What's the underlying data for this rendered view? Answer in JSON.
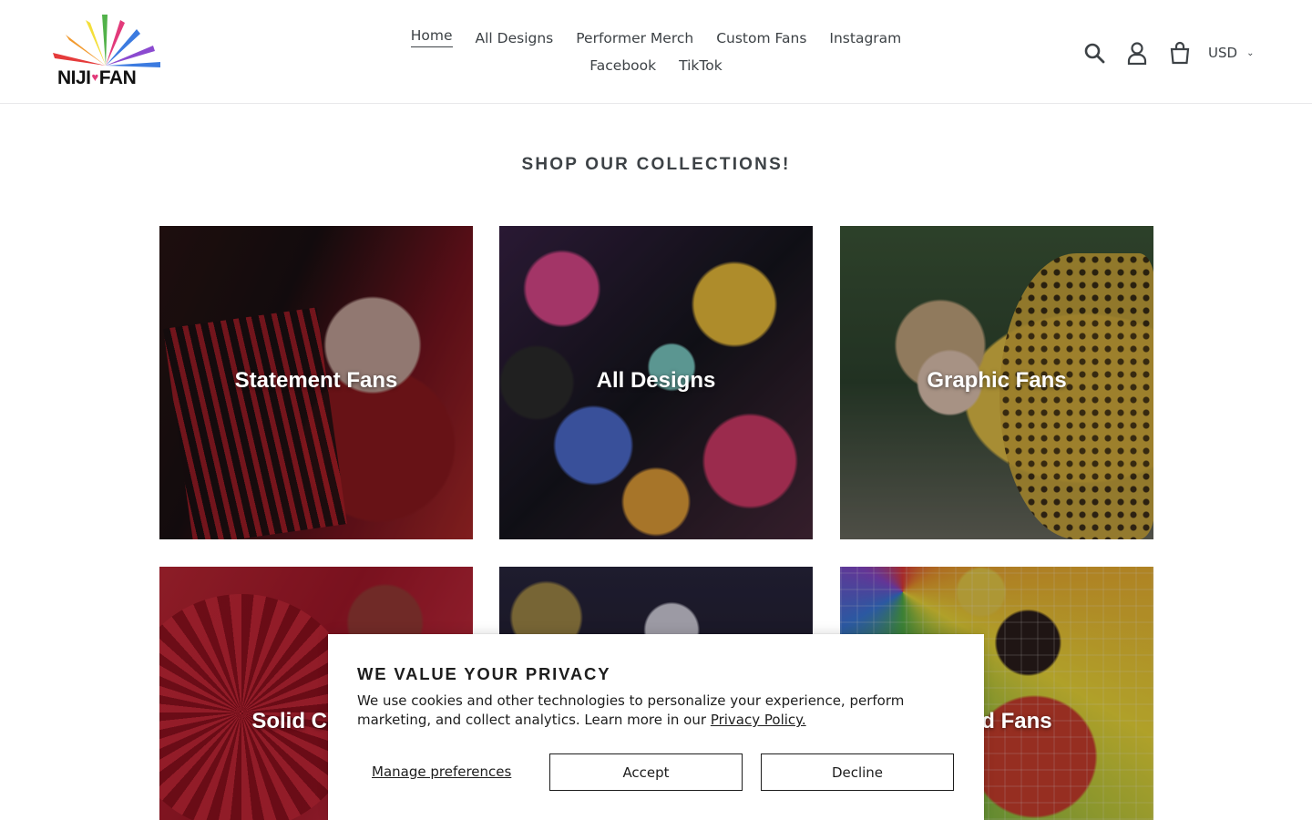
{
  "brand": {
    "logo_text": "NIJI",
    "logo_text_suffix": "FAN",
    "logo_colors": [
      "#e53b3b",
      "#f29a2e",
      "#f4df3a",
      "#52b24a",
      "#3c7be0",
      "#8b4ad0",
      "#e23a7a"
    ]
  },
  "nav": {
    "row1": [
      {
        "label": "Home",
        "active": true
      },
      {
        "label": "All Designs"
      },
      {
        "label": "Performer Merch"
      },
      {
        "label": "Custom Fans"
      },
      {
        "label": "Instagram"
      }
    ],
    "row2": [
      {
        "label": "Facebook"
      },
      {
        "label": "TikTok"
      }
    ]
  },
  "header_icons": [
    "search-icon",
    "account-icon",
    "cart-icon"
  ],
  "currency": {
    "selected": "USD"
  },
  "section": {
    "title": "SHOP OUR COLLECTIONS!"
  },
  "collections": [
    {
      "label": "Statement Fans"
    },
    {
      "label": "All Designs"
    },
    {
      "label": "Graphic Fans"
    },
    {
      "label": "Solid Colors"
    },
    {
      "label": ""
    },
    {
      "label": "Loud Fans"
    }
  ],
  "cookie": {
    "title": "WE VALUE YOUR PRIVACY",
    "text": "We use cookies and other technologies to personalize your experience, perform marketing, and collect analytics. Learn more in our",
    "link": "Privacy Policy.",
    "manage": "Manage preferences",
    "accept": "Accept",
    "decline": "Decline"
  }
}
